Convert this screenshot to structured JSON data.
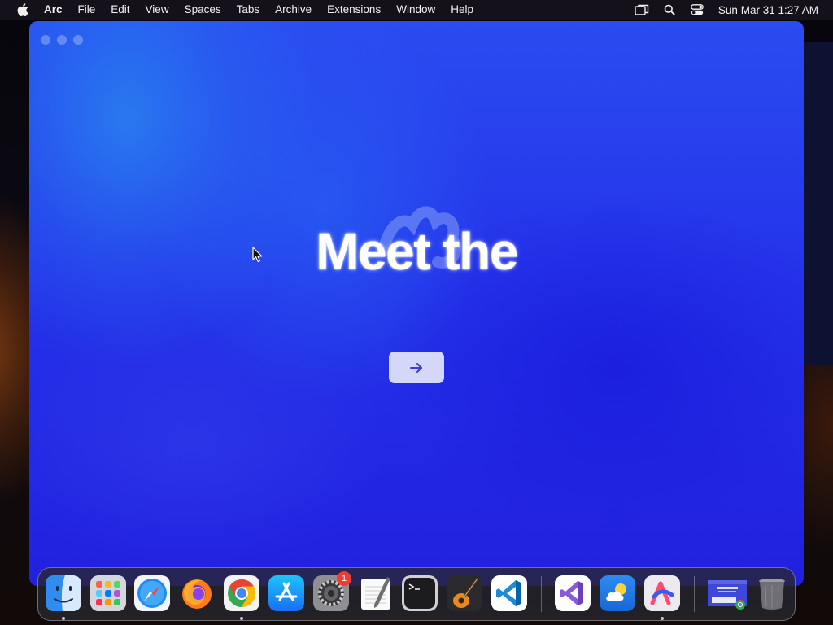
{
  "menubar": {
    "apple_icon": "apple-logo-icon",
    "app_name": "Arc",
    "items": [
      "File",
      "Edit",
      "View",
      "Spaces",
      "Tabs",
      "Archive",
      "Extensions",
      "Window",
      "Help"
    ],
    "status_icons": [
      "screen-mirroring-icon",
      "search-icon",
      "control-center-icon"
    ],
    "clock": "Sun Mar 31  1:27 AM"
  },
  "window": {
    "app": "Arc",
    "headline": "Meet the",
    "next_button_icon": "arrow-right-icon",
    "traffic_lights": [
      "close",
      "minimize",
      "zoom"
    ]
  },
  "dock": {
    "apps": [
      {
        "name": "Finder",
        "icon": "finder-icon",
        "running": true
      },
      {
        "name": "Launchpad",
        "icon": "launchpad-icon",
        "running": false
      },
      {
        "name": "Safari",
        "icon": "safari-icon",
        "running": false
      },
      {
        "name": "Firefox",
        "icon": "firefox-icon",
        "running": false
      },
      {
        "name": "Google Chrome",
        "icon": "chrome-icon",
        "running": true
      },
      {
        "name": "App Store",
        "icon": "app-store-icon",
        "running": false
      },
      {
        "name": "System Settings",
        "icon": "settings-gear-icon",
        "running": false,
        "badge": "1"
      },
      {
        "name": "TextEdit",
        "icon": "textedit-icon",
        "running": false
      },
      {
        "name": "Terminal",
        "icon": "terminal-icon",
        "running": false
      },
      {
        "name": "GarageBand",
        "icon": "garageband-icon",
        "running": false
      },
      {
        "name": "Visual Studio Code",
        "icon": "vscode-icon",
        "running": false
      },
      {
        "name": "Visual Studio",
        "icon": "visual-studio-icon",
        "running": false
      },
      {
        "name": "Weather",
        "icon": "weather-icon",
        "running": false
      },
      {
        "name": "Arc",
        "icon": "arc-icon",
        "running": true
      }
    ],
    "recent": {
      "name": "Chrome web app window",
      "icon": "chrome-web-app-thumbnail-icon"
    },
    "trash": {
      "name": "Trash",
      "icon": "trash-icon"
    },
    "badge_text": "1"
  },
  "colors": {
    "window_blue": "#2533ea",
    "badge_red": "#f23b30",
    "button_bg": "#e4e6fa",
    "arrow": "#3a3bd8"
  }
}
